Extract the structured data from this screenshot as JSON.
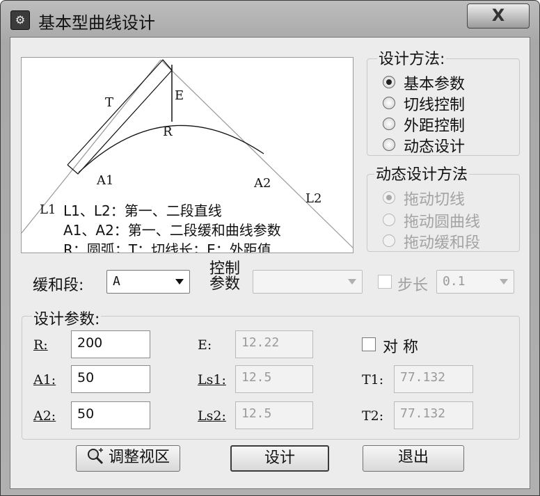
{
  "window": {
    "title": "基本型曲线设计",
    "close_label": "X"
  },
  "diagram": {
    "labels": {
      "T": "T",
      "E": "E",
      "R": "R",
      "A1": "A1",
      "A2": "A2",
      "L1": "L1",
      "L2": "L2"
    },
    "legend": [
      "L1、L2：第一、二段直线",
      "A1、A2：第一、二段缓和曲线参数",
      "R：圆弧；T：切线长；E：外距值"
    ]
  },
  "design_method": {
    "title": "设计方法:",
    "options": [
      "基本参数",
      "切线控制",
      "外距控制",
      "动态设计"
    ],
    "selected": "基本参数"
  },
  "dynamic_method": {
    "title": "动态设计方法",
    "options": [
      "拖动切线",
      "拖动圆曲线",
      "拖动缓和段"
    ],
    "selected": "拖动切线"
  },
  "controls": {
    "transition_label": "缓和段:",
    "transition_value": "A",
    "control_param_label_1": "控制",
    "control_param_label_2": "参数",
    "control_param_value": "",
    "step_label": "步长",
    "step_value": "0.1"
  },
  "params": {
    "title": "设计参数:",
    "R_label": "R:",
    "R_value": "200",
    "A1_label": "A1:",
    "A1_value": "50",
    "A2_label": "A2:",
    "A2_value": "50",
    "E_label": "E:",
    "E_value": "12.22",
    "Ls1_label": "Ls1:",
    "Ls1_value": "12.5",
    "Ls2_label": "Ls2:",
    "Ls2_value": "12.5",
    "symmetric_label": "对 称",
    "T1_label": "T1:",
    "T1_value": "77.132",
    "T2_label": "T2:",
    "T2_value": "77.132"
  },
  "buttons": {
    "adjust_view": "调整视区",
    "design": "设计",
    "exit": "退出"
  }
}
